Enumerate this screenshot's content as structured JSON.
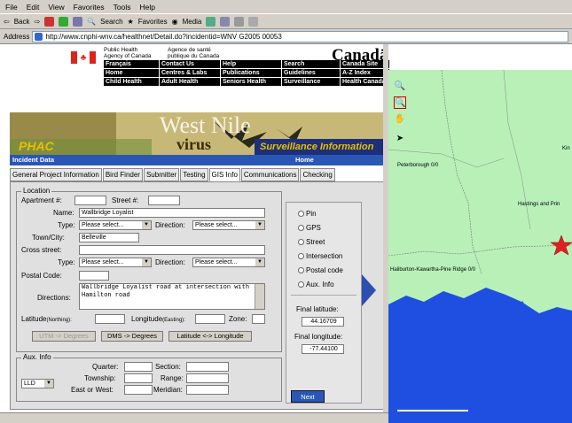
{
  "menu": [
    "File",
    "Edit",
    "View",
    "Favorites",
    "Tools",
    "Help"
  ],
  "toolbar": {
    "back": "Back",
    "search": "Search",
    "favorites": "Favorites",
    "media": "Media"
  },
  "address": {
    "label": "Address",
    "url": "http://www.cnphi-wnv.ca/healthnet/Detail.do?incidentid=WNV G2005 00053"
  },
  "header": {
    "dept_en1": "Public Health",
    "dept_en2": "Agency of Canada",
    "dept_fr1": "Agence de santé",
    "dept_fr2": "publique du Canada",
    "wordmark": "Canadä",
    "nav": [
      "Français",
      "Contact Us",
      "Help",
      "Search",
      "Canada Site",
      "Home",
      "Centres & Labs",
      "Publications",
      "Guidelines",
      "A-Z Index",
      "Child Health",
      "Adult Health",
      "Seniors Health",
      "Surveillance",
      "Health Canada"
    ]
  },
  "banner": {
    "west": "West Nile",
    "virus": "virus",
    "phac": "PHAC",
    "surv": "Surveillance Information"
  },
  "incident": {
    "title": "Incident Data",
    "home": "Home"
  },
  "tabs": [
    "General Project Information",
    "Bird Finder",
    "Submitter",
    "Testing",
    "GIS Info",
    "Communications",
    "Checking"
  ],
  "location": {
    "legend": "Location",
    "apartment": "Apartment #:",
    "street_no": "Street #:",
    "name_lbl": "Name:",
    "name_val": "Wallbridge Loyalist",
    "type_lbl": "Type:",
    "select_placeholder": "Please select...",
    "direction_lbl": "Direction:",
    "town_lbl": "Town/City:",
    "town_val": "Belleville",
    "cross_lbl": "Cross street:",
    "postal_lbl": "Postal Code:",
    "directions_lbl": "Directions:",
    "directions_val": "Wallbridge Loyalist road at intersection with Hamilton road",
    "lat_lbl": "Latitude",
    "lat_sub": "(Northing):",
    "lon_lbl": "Longitude",
    "lon_sub": "(Easting):",
    "zone_lbl": "Zone:",
    "btn_utm": "UTM -> Degrees",
    "btn_dms": "DMS -> Degrees",
    "btn_lat": "Latitude <-> Longitude"
  },
  "aux": {
    "legend": "Aux. Info",
    "quarter": "Quarter:",
    "section": "Section:",
    "township": "Township:",
    "range": "Range:",
    "eastwest": "East or West:",
    "meridian": "Meridian:",
    "lld": "LLD"
  },
  "gis": {
    "options": [
      "Pin",
      "GPS",
      "Street",
      "Intersection",
      "Postal code",
      "Aux. Info"
    ],
    "final_lat_lbl": "Final latitude:",
    "final_lat": "44.16709",
    "final_lon_lbl": "Final longitude:",
    "final_lon": "-77.44100",
    "next": "Next"
  },
  "map": {
    "labels": [
      "Peterborough 0/0",
      "Hastings and Prin",
      "Haliburton-Kawartha-Pine Ridge 0/0",
      "Kin"
    ]
  },
  "colors": {
    "nav_bg": "#000000",
    "incident_bar": "#2a57b5",
    "map_land": "#b8f0b8",
    "map_water": "#1f4fe0",
    "marker": "#e02020"
  }
}
